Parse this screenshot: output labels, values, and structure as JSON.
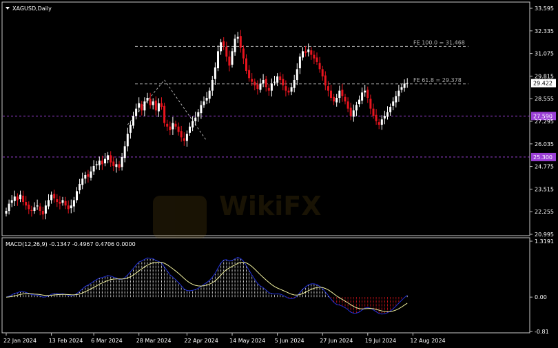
{
  "chart_data": [
    {
      "type": "candlestick",
      "title": "XAGUSD,Daily",
      "ylim": [
        20.995,
        33.595
      ],
      "y_ticks": [
        "33.595",
        "32.335",
        "31.075",
        "29.815",
        "28.555",
        "27.295",
        "26.035",
        "24.775",
        "23.515",
        "22.255",
        "20.995"
      ],
      "x_ticks": [
        "22 Jan 2024",
        "13 Feb 2024",
        "6 Mar 2024",
        "28 Mar 2024",
        "22 Apr 2024",
        "14 May 2024",
        "5 Jun 2024",
        "27 Jun 2024",
        "19 Jul 2024",
        "12 Aug 2024"
      ],
      "x_tick_index": [
        0,
        16,
        31,
        47,
        64,
        80,
        96,
        112,
        128,
        144
      ],
      "current_price": "29.422",
      "horizontal_levels": [
        {
          "label": "27.590",
          "value": 27.59,
          "color": "#9b3fd6"
        },
        {
          "label": "25.300",
          "value": 25.3,
          "color": "#9b3fd6"
        }
      ],
      "fibonacci": [
        {
          "label": "FE 100.0 = 31.468",
          "value": 31.468
        },
        {
          "label": "FE 61.8 = 29.378",
          "value": 29.378
        }
      ],
      "closes": [
        22.3,
        22.7,
        22.9,
        23.1,
        22.9,
        23.2,
        22.8,
        22.6,
        22.4,
        22.3,
        22.5,
        22.6,
        22.3,
        22.1,
        22.6,
        22.9,
        23.2,
        23.0,
        22.8,
        22.7,
        22.9,
        22.6,
        22.4,
        22.6,
        22.9,
        23.4,
        23.8,
        24.1,
        24.3,
        24.2,
        24.5,
        24.8,
        24.9,
        25.1,
        24.9,
        25.2,
        25.4,
        25.0,
        24.8,
        24.9,
        24.7,
        25.3,
        25.9,
        26.6,
        27.1,
        27.6,
        28.0,
        28.3,
        27.9,
        28.4,
        28.6,
        28.2,
        28.4,
        27.9,
        28.3,
        28.1,
        27.2,
        27.0,
        26.8,
        27.2,
        27.0,
        26.7,
        26.4,
        26.2,
        26.6,
        27.0,
        27.3,
        27.5,
        27.8,
        28.2,
        28.4,
        28.6,
        29.0,
        29.6,
        30.3,
        31.2,
        31.7,
        31.5,
        30.9,
        30.4,
        31.2,
        31.9,
        32.0,
        31.4,
        30.8,
        30.1,
        29.7,
        29.5,
        29.3,
        29.1,
        29.4,
        29.6,
        29.2,
        29.0,
        29.4,
        29.5,
        29.8,
        29.6,
        29.3,
        29.0,
        28.9,
        29.2,
        29.6,
        30.2,
        30.9,
        31.2,
        31.1,
        31.3,
        31.0,
        30.8,
        30.6,
        30.2,
        29.8,
        29.3,
        29.0,
        28.6,
        28.4,
        28.6,
        29.0,
        28.7,
        28.4,
        28.0,
        27.6,
        27.9,
        28.2,
        28.5,
        28.9,
        29.0,
        28.6,
        28.0,
        27.6,
        27.3,
        27.1,
        27.4,
        27.6,
        27.8,
        28.1,
        28.4,
        28.7,
        29.0,
        29.2,
        29.4,
        29.422
      ],
      "series_colors": {
        "up": "#ffffff",
        "down": "#e8141e"
      }
    },
    {
      "type": "bar+line",
      "title": "MACD(12,26,9) -0.1347 -0.4967 0.4706 0.0000",
      "ylim": [
        -0.81,
        1.3191
      ],
      "y_ticks": [
        "1.3191",
        "0.00",
        "-0.81"
      ],
      "main_line_color": "#1f2fd6",
      "signal_line_color": "#f2f2a0",
      "histogram_pos_color": "#ffffff",
      "histogram_neg_color": "#e8141e"
    }
  ]
}
